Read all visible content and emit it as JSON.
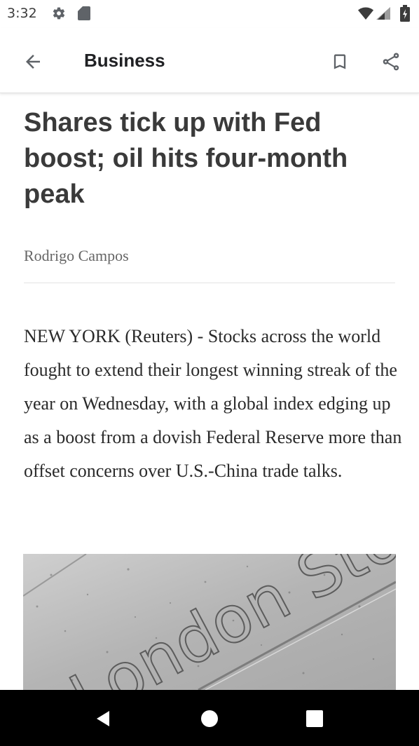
{
  "status_bar": {
    "time": "3:32",
    "icons": [
      "gear-icon",
      "sd-card-icon",
      "wifi-icon",
      "signal-icon",
      "battery-icon"
    ]
  },
  "app_bar": {
    "title": "Business",
    "icons": [
      "arrow-back-icon",
      "bookmark-icon",
      "share-icon"
    ]
  },
  "article": {
    "headline": "Shares tick up with Fed boost; oil hits four-month peak",
    "byline": "Rodrigo Campos",
    "body": "NEW YORK (Reuters) - Stocks across the world fought to extend their longest winning streak of the year on Wednesday, with a global index edging up as a boost from a dovish Federal Reserve more than offset concerns over U.S.-China trade talks.",
    "photo_text": "London Stock Exchange"
  },
  "nav_bar": {
    "icons": [
      "nav-back-icon",
      "nav-home-icon",
      "nav-recents-icon"
    ]
  },
  "colors": {
    "nav_bar": "#000000",
    "headline": "#3a3a3a",
    "byline": "#666666"
  }
}
